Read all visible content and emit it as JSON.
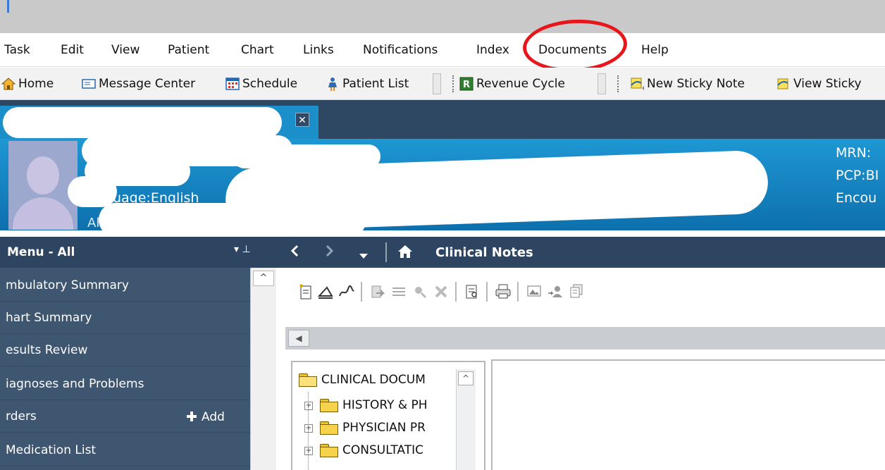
{
  "menubar": {
    "items": [
      "Task",
      "Edit",
      "View",
      "Patient",
      "Chart",
      "Links",
      "Notifications",
      "Index",
      "Documents",
      "Help"
    ]
  },
  "toolbar": {
    "home": "Home",
    "message_center": "Message Center",
    "schedule": "Schedule",
    "patient_list": "Patient List",
    "revenue_cycle": "Revenue Cycle",
    "new_sticky_note": "New Sticky Note",
    "view_sticky": "View Sticky"
  },
  "patient_tab": {
    "close_glyph": "✕"
  },
  "banner": {
    "language": "uage:English",
    "mrn": "MRN:",
    "pcp": "PCP:BI",
    "encounter": "Encou",
    "partial_a": "Al"
  },
  "sidebar": {
    "header": "Menu - All",
    "pin_glyph": "▾ ⊥",
    "items": [
      "mbulatory Summary",
      "hart Summary",
      "esults Review",
      "iagnoses and Problems",
      "rders",
      "Medication List"
    ],
    "add_label": "Add"
  },
  "content_nav": {
    "title": "Clinical Notes"
  },
  "tree": {
    "items": [
      "CLINICAL DOCUM",
      "HISTORY & PH",
      "PHYSICIAN PR",
      "CONSULTATIC"
    ]
  },
  "colors": {
    "accent_blue": "#1a8fc9",
    "nav_dark": "#2d4560",
    "sidebar_bg": "#3f5670",
    "annotation_red": "#e8161b"
  }
}
